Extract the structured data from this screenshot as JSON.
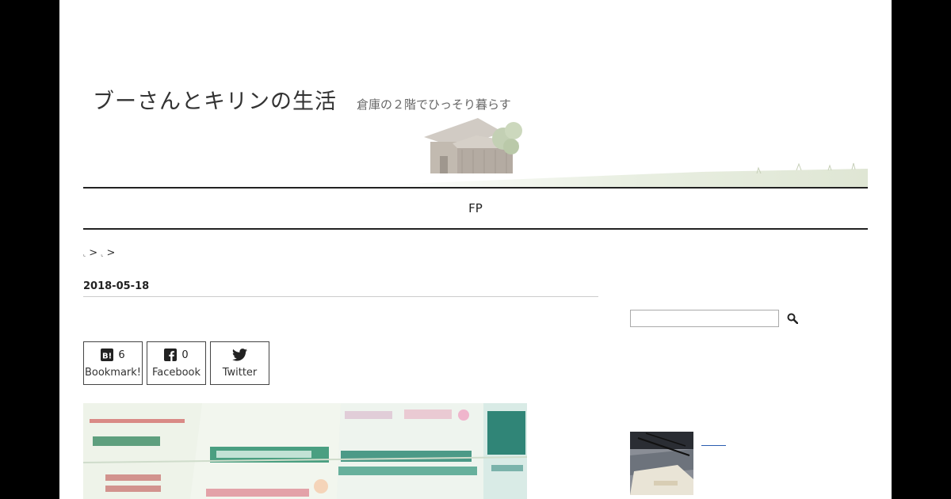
{
  "header": {
    "site_title": "ブーさんとキリンの生活",
    "site_description": "倉庫の２階でひっそり暮らす"
  },
  "nav": {
    "items": [
      {
        "label": "FP"
      }
    ]
  },
  "breadcrumb": {
    "separator": ">"
  },
  "post": {
    "date": "2018-05-18",
    "share": {
      "hatena": {
        "label": "Bookmark!",
        "count": "6",
        "icon": "hatena-bookmark-icon"
      },
      "facebook": {
        "label": "Facebook",
        "count": "0",
        "icon": "facebook-icon"
      },
      "twitter": {
        "label": "Twitter",
        "icon": "twitter-bird-icon"
      }
    }
  },
  "sidebar": {
    "search": {
      "value": "",
      "icon": "magnifier-icon"
    }
  }
}
